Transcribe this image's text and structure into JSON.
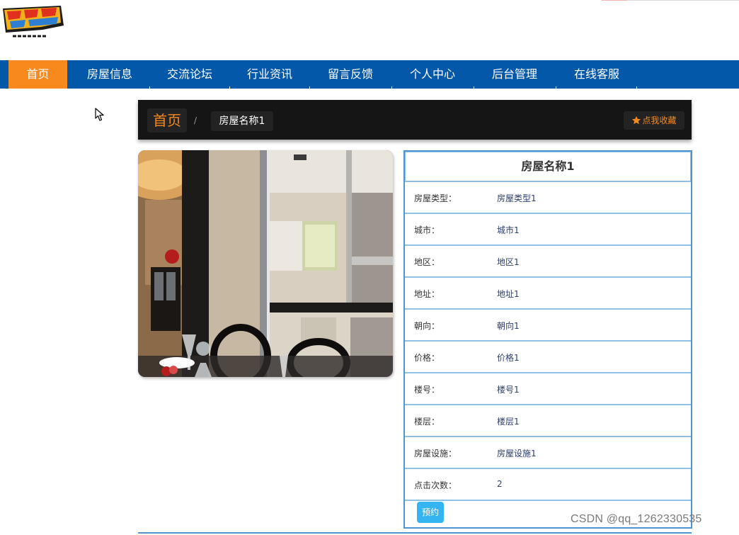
{
  "nav": {
    "items": [
      {
        "label": "首页",
        "active": true
      },
      {
        "label": "房屋信息"
      },
      {
        "label": "交流论坛"
      },
      {
        "label": "行业资讯"
      },
      {
        "label": "留言反馈"
      },
      {
        "label": "个人中心"
      },
      {
        "label": "后台管理"
      },
      {
        "label": "在线客服"
      }
    ]
  },
  "breadcrumb": {
    "home": "首页",
    "separator": "/",
    "current": "房屋名称1",
    "favorite": "点我收藏"
  },
  "detail": {
    "title": "房屋名称1",
    "rows": [
      {
        "label": "房屋类型：",
        "value": "房屋类型1"
      },
      {
        "label": "城市：",
        "value": "城市1"
      },
      {
        "label": "地区：",
        "value": "地区1"
      },
      {
        "label": "地址：",
        "value": "地址1"
      },
      {
        "label": "朝向：",
        "value": "朝向1"
      },
      {
        "label": "价格：",
        "value": "价格1"
      },
      {
        "label": "楼号：",
        "value": "楼号1"
      },
      {
        "label": "楼层：",
        "value": "楼层1"
      },
      {
        "label": "房屋设施：",
        "value": "房屋设施1"
      },
      {
        "label": "点击次数：",
        "value": "2"
      }
    ],
    "book_button": "预约"
  },
  "watermark": "CSDN @qq_1262330535",
  "colors": {
    "nav_bg": "#0458aa",
    "accent": "#f7891d",
    "table_border": "#8ec1e6",
    "button": "#35b4f2"
  },
  "icons": [
    "logo-icon",
    "star-icon",
    "cursor-icon"
  ]
}
